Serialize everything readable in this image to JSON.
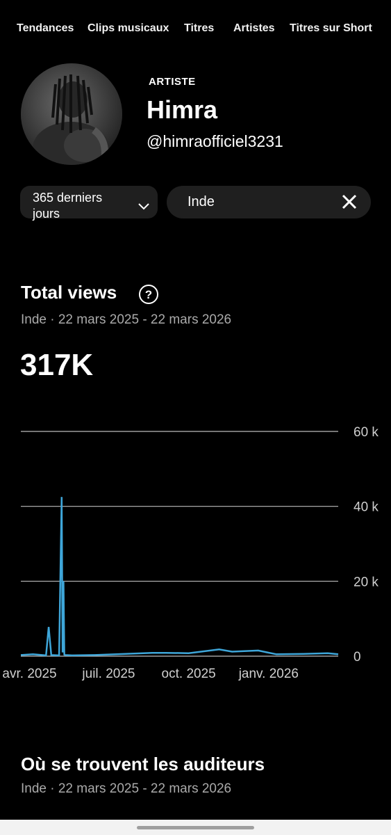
{
  "tabs": [
    "Tendances",
    "Clips musicaux",
    "Titres",
    "Artistes",
    "Titres sur Short"
  ],
  "artist": {
    "label": "ARTISTE",
    "name": "Himra",
    "handle": "@himraofficiel3231"
  },
  "filters": {
    "period": "365 derniers jours",
    "period_line1": "365 derniers",
    "period_line2": "jours",
    "country": "Inde"
  },
  "total_views": {
    "title": "Total views",
    "subtitle": "Inde · 22 mars 2025 - 22 mars 2026",
    "value": "317K"
  },
  "listeners": {
    "title": "Où se trouvent les auditeurs",
    "subtitle": "Inde · 22 mars 2025 - 22 mars 2026"
  },
  "colors": {
    "accent": "#3ea6d9",
    "background": "#000000",
    "chip": "#1f1f1f"
  },
  "chart_data": {
    "type": "line",
    "x": [
      "2025-03-22",
      "2025-04-05",
      "2025-04-20",
      "2025-04-23",
      "2025-04-26",
      "2025-05-05",
      "2025-05-08",
      "2025-05-09",
      "2025-05-10",
      "2025-05-11",
      "2025-05-12",
      "2025-05-20",
      "2025-06-15",
      "2025-07-20",
      "2025-08-20",
      "2025-09-05",
      "2025-10-01",
      "2025-11-05",
      "2025-11-20",
      "2025-12-20",
      "2026-01-10",
      "2026-02-10",
      "2026-03-10",
      "2026-03-22"
    ],
    "series": [
      {
        "values": [
          300,
          500,
          200,
          7800,
          300,
          200,
          42500,
          1000,
          20000,
          400,
          300,
          200,
          300,
          600,
          900,
          900,
          800,
          1800,
          1200,
          1500,
          500,
          600,
          800,
          500
        ]
      }
    ],
    "x_tick_labels": [
      "avr. 2025",
      "juil. 2025",
      "oct. 2025",
      "janv. 2026"
    ],
    "y_tick_labels": [
      "0",
      "20 k",
      "40 k",
      "60 k"
    ],
    "ylim": [
      0,
      60000
    ],
    "grid": true
  }
}
